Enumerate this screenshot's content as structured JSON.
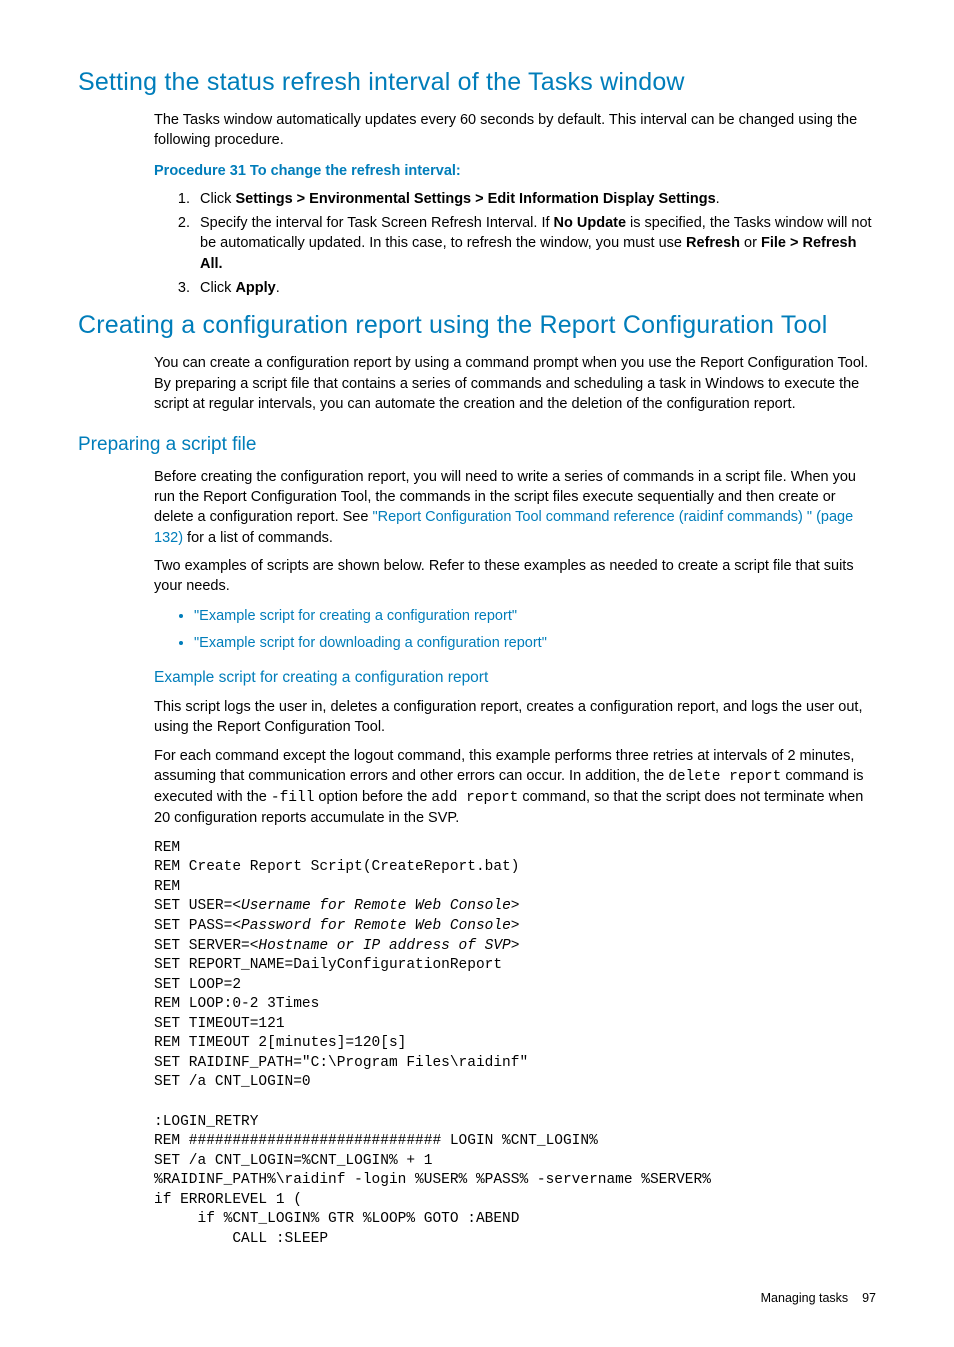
{
  "section1": {
    "title": "Setting the status refresh interval of the Tasks window",
    "intro": "The Tasks window automatically updates every 60 seconds by default. This interval can be changed using the following procedure.",
    "proc_title": "Procedure 31 To change the refresh interval:",
    "step1_a": "Click ",
    "step1_b": "Settings > Environmental Settings > Edit Information Display Settings",
    "step1_c": ".",
    "step2_a": "Specify the interval for Task Screen Refresh Interval. If ",
    "step2_b": "No Update",
    "step2_c": " is specified, the Tasks window will not be automatically updated. In this case, to refresh the window, you must use ",
    "step2_d": "Refresh",
    "step2_e": " or ",
    "step2_f": "File > Refresh All.",
    "step3_a": "Click ",
    "step3_b": "Apply",
    "step3_c": "."
  },
  "section2": {
    "title": "Creating a configuration report using the Report Configuration Tool",
    "para": "You can create a configuration report by using a command prompt when you use the Report Configuration Tool. By preparing a script file that contains a series of commands and scheduling a task in Windows to execute the script at regular intervals, you can automate the creation and the deletion of the configuration report."
  },
  "prep": {
    "title": "Preparing a script file",
    "p1_a": "Before creating the configuration report, you will need to write a series of commands in a script file. When you run the Report Configuration Tool, the commands in the script files execute sequentially and then create or delete a configuration report. See ",
    "p1_link": "\"Report Configuration Tool command reference (raidinf commands) \" (page 132)",
    "p1_b": " for a list of commands.",
    "p2": "Two examples of scripts are shown below. Refer to these examples as needed to create a script file that suits your needs.",
    "bullet1": "\"Example script for creating a configuration report\"",
    "bullet2": "\"Example script for downloading a configuration report\""
  },
  "example": {
    "title": "Example script for creating a configuration report",
    "p1": "This script logs the user in, deletes a configuration report, creates a configuration report, and logs the user out, using the Report Configuration Tool.",
    "p2_a": "For each command except the logout command, this example performs three retries at intervals of 2 minutes, assuming that communication errors and other errors can occur. In addition, the ",
    "p2_code1": "delete report",
    "p2_b": " command is executed with the ",
    "p2_code2": "-fill",
    "p2_c": " option before the ",
    "p2_code3": "add report",
    "p2_d": " command, so that the script does not terminate when 20 configuration reports accumulate in the SVP.",
    "script_l1": "REM",
    "script_l2": "REM Create Report Script(CreateReport.bat)",
    "script_l3": "REM",
    "script_l4a": "SET USER=",
    "script_l4b": "<Username for Remote Web Console>",
    "script_l5a": "SET PASS=",
    "script_l5b": "<Password for Remote Web Console>",
    "script_l6a": "SET SERVER=",
    "script_l6b": "<Hostname or IP address of SVP>",
    "script_l7": "SET REPORT_NAME=DailyConfigurationReport",
    "script_l8": "SET LOOP=2",
    "script_l9": "REM LOOP:0-2 3Times",
    "script_l10": "SET TIMEOUT=121",
    "script_l11": "REM TIMEOUT 2[minutes]=120[s]",
    "script_l12": "SET RAIDINF_PATH=\"C:\\Program Files\\raidinf\"",
    "script_l13": "SET /a CNT_LOGIN=0",
    "script_l14": "",
    "script_l15": ":LOGIN_RETRY",
    "script_l16": "REM ############################# LOGIN %CNT_LOGIN%",
    "script_l17": "SET /a CNT_LOGIN=%CNT_LOGIN% + 1",
    "script_l18": "%RAIDINF_PATH%\\raidinf -login %USER% %PASS% -servername %SERVER%",
    "script_l19": "if ERRORLEVEL 1 (",
    "script_l20": "     if %CNT_LOGIN% GTR %LOOP% GOTO :ABEND",
    "script_l21": "         CALL :SLEEP"
  },
  "footer": {
    "label": "Managing tasks",
    "page": "97"
  }
}
